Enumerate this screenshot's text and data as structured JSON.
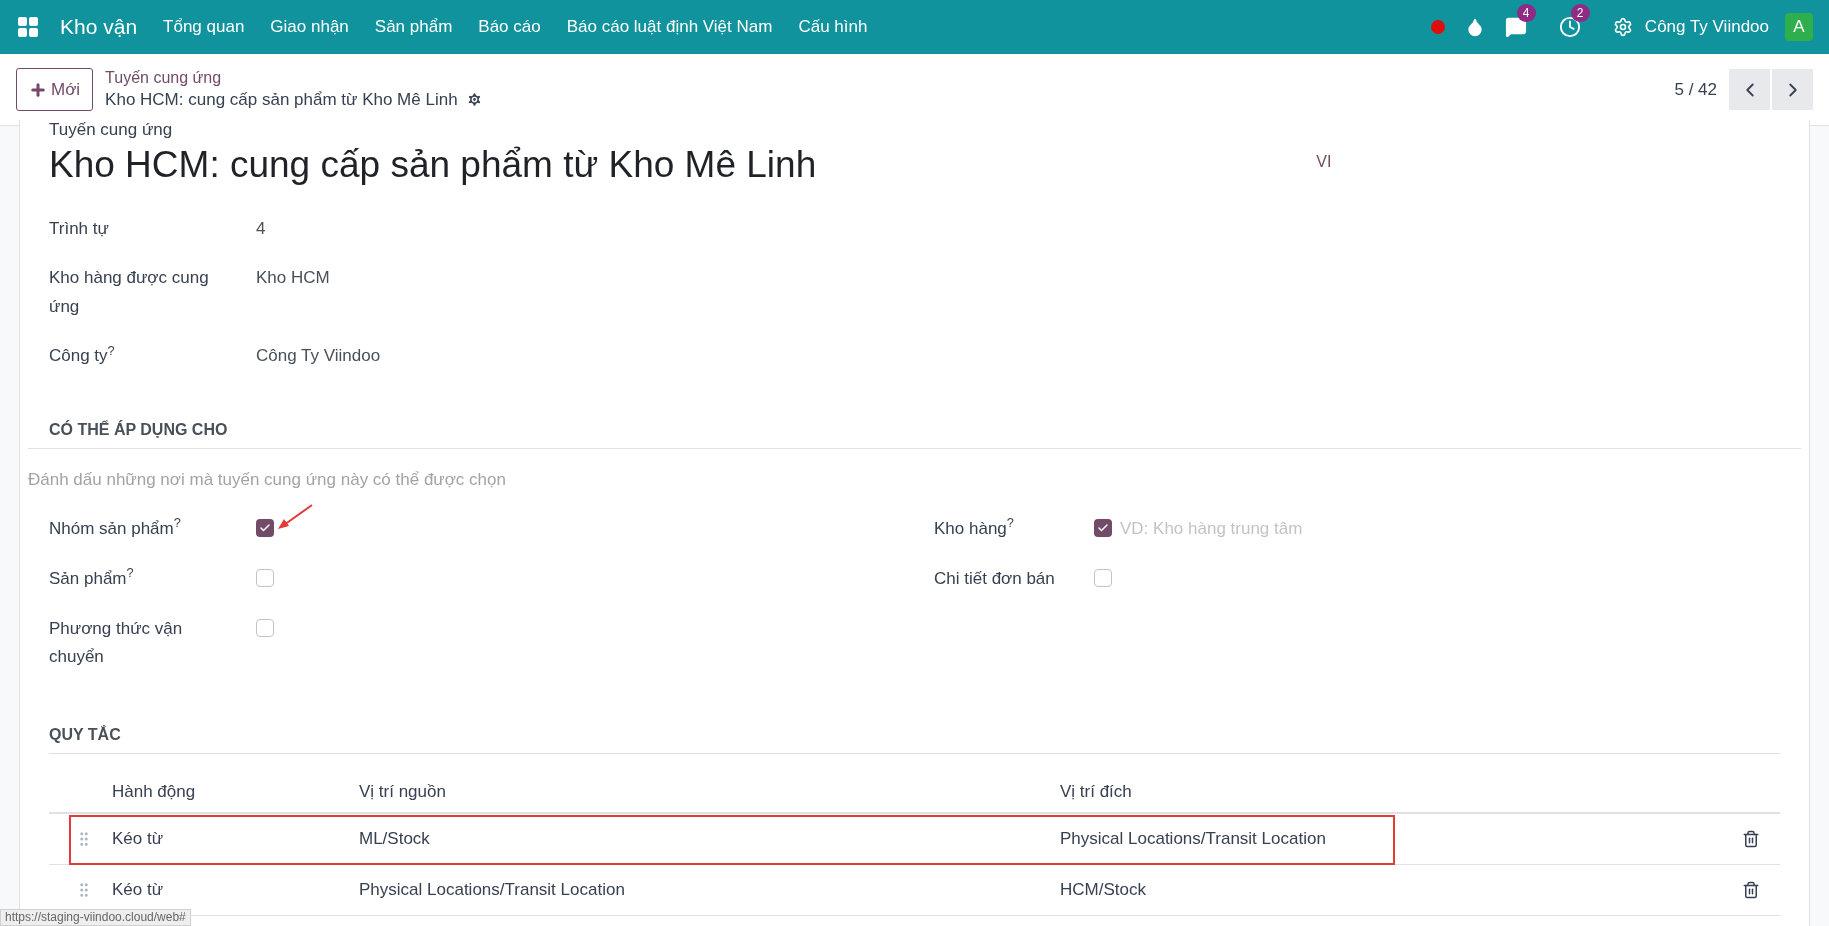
{
  "navbar": {
    "app_name": "Kho vận",
    "menu": [
      "Tổng quan",
      "Giao nhận",
      "Sản phẩm",
      "Báo cáo",
      "Báo cáo luật định Việt Nam",
      "Cấu hình"
    ],
    "messages_count": "4",
    "activities_count": "2",
    "company": "Công Ty Viindoo",
    "avatar": "A"
  },
  "control_panel": {
    "new_button": "Mới",
    "breadcrumb_parent": "Tuyến cung ứng",
    "breadcrumb_current": "Kho HCM: cung cấp sản phẩm từ Kho Mê Linh",
    "pager": "5 / 42"
  },
  "form": {
    "title_label": "Tuyến cung ứng",
    "title": "Kho HCM: cung cấp sản phẩm từ Kho Mê Linh",
    "language": "VI",
    "fields": [
      {
        "label": "Trình tự",
        "value": "4"
      },
      {
        "label": "Kho hàng được cung ứng",
        "value": "Kho HCM"
      },
      {
        "label": "Công ty$^{?}$",
        "value": "Công Ty Viindoo"
      }
    ],
    "applicability": {
      "title": "CÓ THỂ ÁP DỤNG CHO",
      "hint": "Đánh dấu những nơi mà tuyến cung ứng này có thể được chọn",
      "left": [
        {
          "label": "Nhóm sản phẩm$^{?}$",
          "checked": true,
          "annotated": true
        },
        {
          "label": "Sản phẩm$^{?}$",
          "checked": false,
          "annotated": false
        },
        {
          "label": "Phương thức vận chuyển",
          "checked": false,
          "annotated": false
        }
      ],
      "right": [
        {
          "label": "Kho hàng$^{?}$",
          "checked": true,
          "placeholder": "VD: Kho hàng trung tâm"
        },
        {
          "label": "Chi tiết đơn bán",
          "checked": false
        }
      ]
    },
    "rules": {
      "title": "QUY TẮC",
      "columns": [
        "Hành động",
        "Vị trí nguồn",
        "Vị trí đích"
      ],
      "rows": [
        {
          "action": "Kéo từ",
          "source": "ML/Stock",
          "destination": "Physical Locations/Transit Location",
          "highlighted": true
        },
        {
          "action": "Kéo từ",
          "source": "Physical Locations/Transit Location",
          "destination": "HCM/Stock",
          "highlighted": false
        }
      ]
    }
  },
  "status_url": "https://staging-viindoo.cloud/web#"
}
